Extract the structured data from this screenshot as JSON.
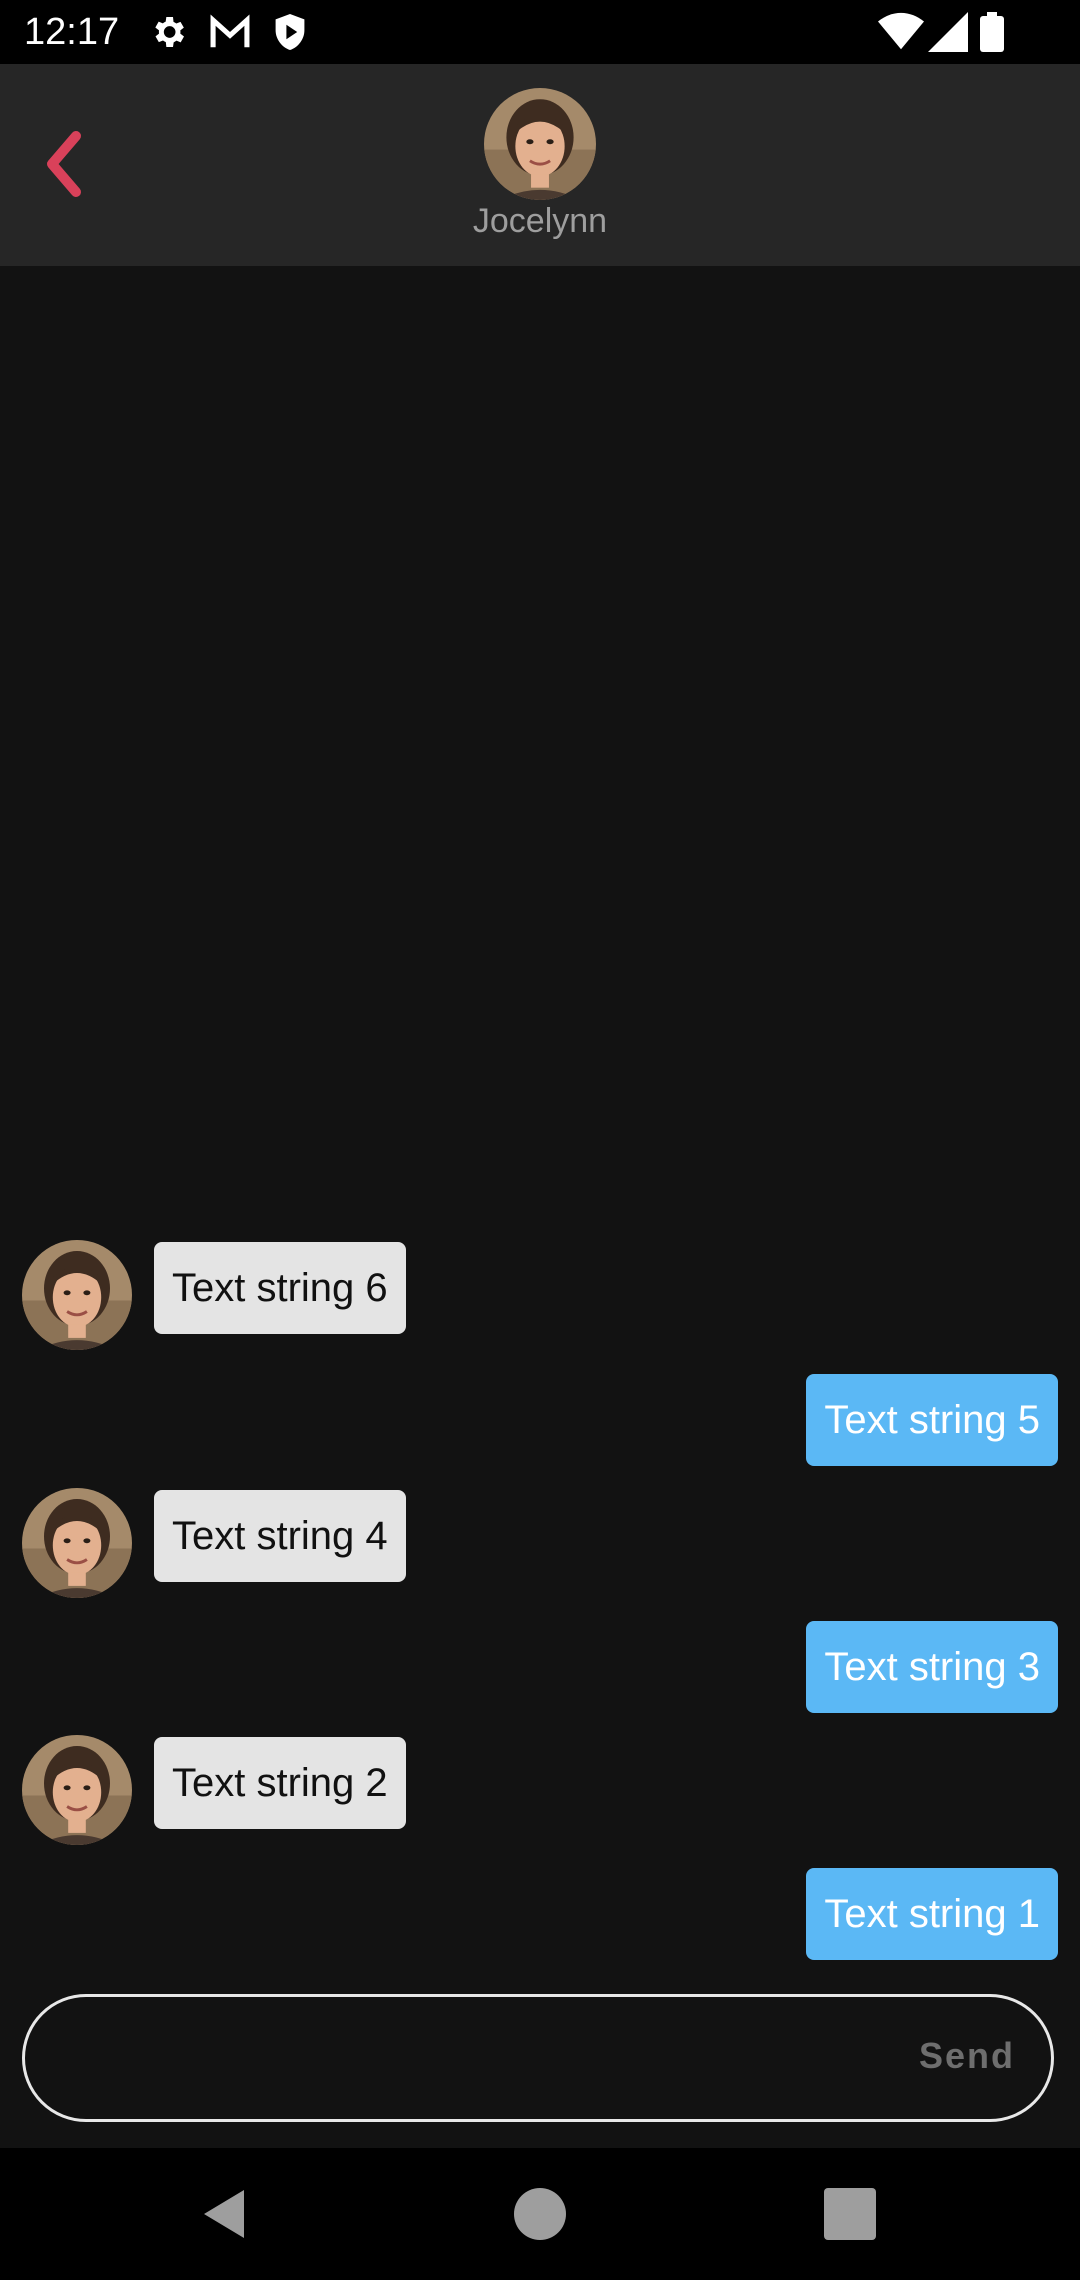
{
  "status_bar": {
    "time": "12:17",
    "icons": [
      "gear-icon",
      "gmail-icon",
      "shield-icon",
      "wifi-icon",
      "signal-icon",
      "battery-icon"
    ]
  },
  "header": {
    "back_icon": "chevron-left-icon",
    "contact_name": "Jocelynn",
    "accent_color": "#d9415a"
  },
  "messages": [
    {
      "direction": "incoming",
      "text": "Text string 6"
    },
    {
      "direction": "outgoing",
      "text": "Text string 5"
    },
    {
      "direction": "incoming",
      "text": "Text string 4"
    },
    {
      "direction": "outgoing",
      "text": "Text string 3"
    },
    {
      "direction": "incoming",
      "text": "Text string 2"
    },
    {
      "direction": "outgoing",
      "text": "Text string 1"
    }
  ],
  "composer": {
    "value": "",
    "placeholder": "",
    "send_label": "Send"
  },
  "colors": {
    "incoming_bubble": "#e4e4e4",
    "outgoing_bubble": "#5bb8f5",
    "background": "#121212",
    "app_bar": "#262626"
  },
  "nav_bar": {
    "icons": [
      "back-triangle-icon",
      "home-circle-icon",
      "recents-square-icon"
    ]
  }
}
